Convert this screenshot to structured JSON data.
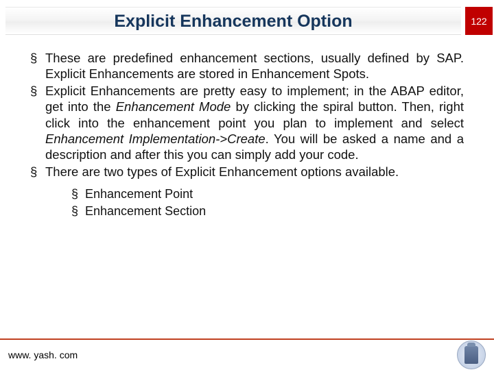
{
  "header": {
    "title": "Explicit Enhancement Option",
    "page_number": "122"
  },
  "bullets": [
    {
      "parts": [
        {
          "text": "These are predefined enhancement sections, usually defined by SAP. Explicit Enhancements are stored in Enhancement Spots."
        }
      ]
    },
    {
      "parts": [
        {
          "text": "Explicit Enhancements are pretty easy to implement; in the ABAP editor, get into the "
        },
        {
          "text": "Enhancement Mode",
          "italic": true
        },
        {
          "text": " by clicking the spiral button. Then, right click into the enhancement point you plan to implement and select "
        },
        {
          "text": "Enhancement Implementation->Create",
          "italic": true
        },
        {
          "text": ". You will be asked a name and a description and after this you can simply add your code."
        }
      ]
    },
    {
      "parts": [
        {
          "text": "There are two types of Explicit Enhancement options available."
        }
      ]
    }
  ],
  "sub_bullets": [
    "Enhancement Point",
    "Enhancement Section"
  ],
  "footer": {
    "url": "www. yash. com"
  }
}
